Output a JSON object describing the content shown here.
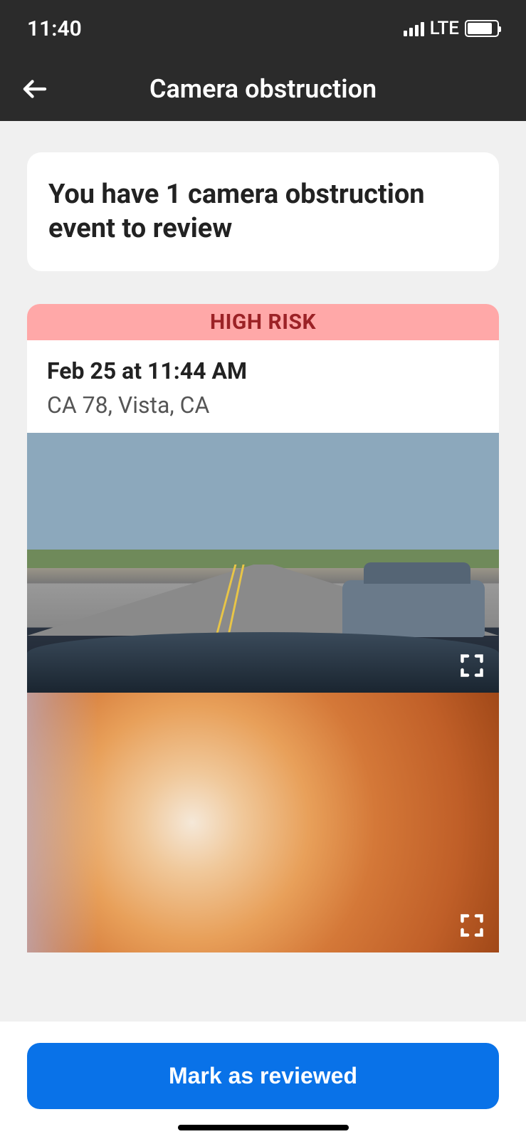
{
  "status_bar": {
    "time": "11:40",
    "network_type": "LTE"
  },
  "header": {
    "title": "Camera obstruction"
  },
  "summary": {
    "text": "You have 1 camera obstruction event to review"
  },
  "event": {
    "risk_label": "HIGH RISK",
    "timestamp": "Feb 25 at 11:44 AM",
    "location": "CA 78, Vista, CA"
  },
  "actions": {
    "mark_reviewed_label": "Mark as reviewed"
  }
}
